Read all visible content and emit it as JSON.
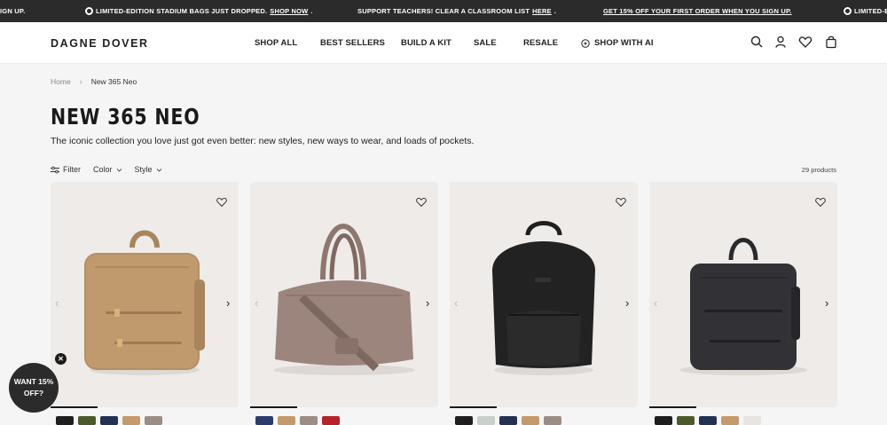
{
  "announcements": [
    {
      "text": "IGN UP.",
      "link": ""
    },
    {
      "text": "LIMITED-EDITION STADIUM BAGS JUST DROPPED. ",
      "link": "SHOP NOW",
      "suffix": "."
    },
    {
      "text": "SUPPORT TEACHERS! CLEAR A CLASSROOM LIST ",
      "link": "HERE",
      "suffix": "."
    },
    {
      "text": "GET 15% OFF YOUR FIRST ORDER WHEN YOU SIGN UP.",
      "link": ""
    },
    {
      "text": "LIMITED-EI",
      "link": ""
    }
  ],
  "header": {
    "logo": "DAGNE DOVER",
    "nav": [
      "SHOP ALL",
      "BEST SELLERS",
      "BUILD A KIT",
      "SALE",
      "RESALE",
      "SHOP WITH AI"
    ],
    "icons": [
      "search-icon",
      "account-icon",
      "wishlist-icon",
      "cart-icon"
    ]
  },
  "breadcrumb": {
    "home": "Home",
    "current": "New 365 Neo"
  },
  "page": {
    "title": "NEW 365 NEO",
    "subtitle": "The iconic collection you love just got even better: new styles, new ways to wear, and loads of pockets.",
    "filter_label": "Filter",
    "color_label": "Color",
    "style_label": "Style",
    "product_count": "29 products"
  },
  "products": [
    {
      "bag": "backpack-tan",
      "colors": [
        "#1f1f1f",
        "#4c5a2b",
        "#243252",
        "#c49a6c",
        "#9b8d86"
      ]
    },
    {
      "bag": "duffel-taupe",
      "colors": [
        "#2b3b6b",
        "#c49a6c",
        "#9b8d86",
        "#b5242a"
      ]
    },
    {
      "bag": "backpack-black",
      "colors": [
        "#1f1f1f",
        "#c8d0cc",
        "#243252",
        "#c49a6c",
        "#9b8d86"
      ]
    },
    {
      "bag": "backpack-dark",
      "colors": [
        "#1f1f1f",
        "#4c5a2b",
        "#243252",
        "#c49a6c",
        "#e8e4e0"
      ]
    }
  ],
  "promo": {
    "line1": "WANT 15%",
    "line2": "OFF?"
  }
}
